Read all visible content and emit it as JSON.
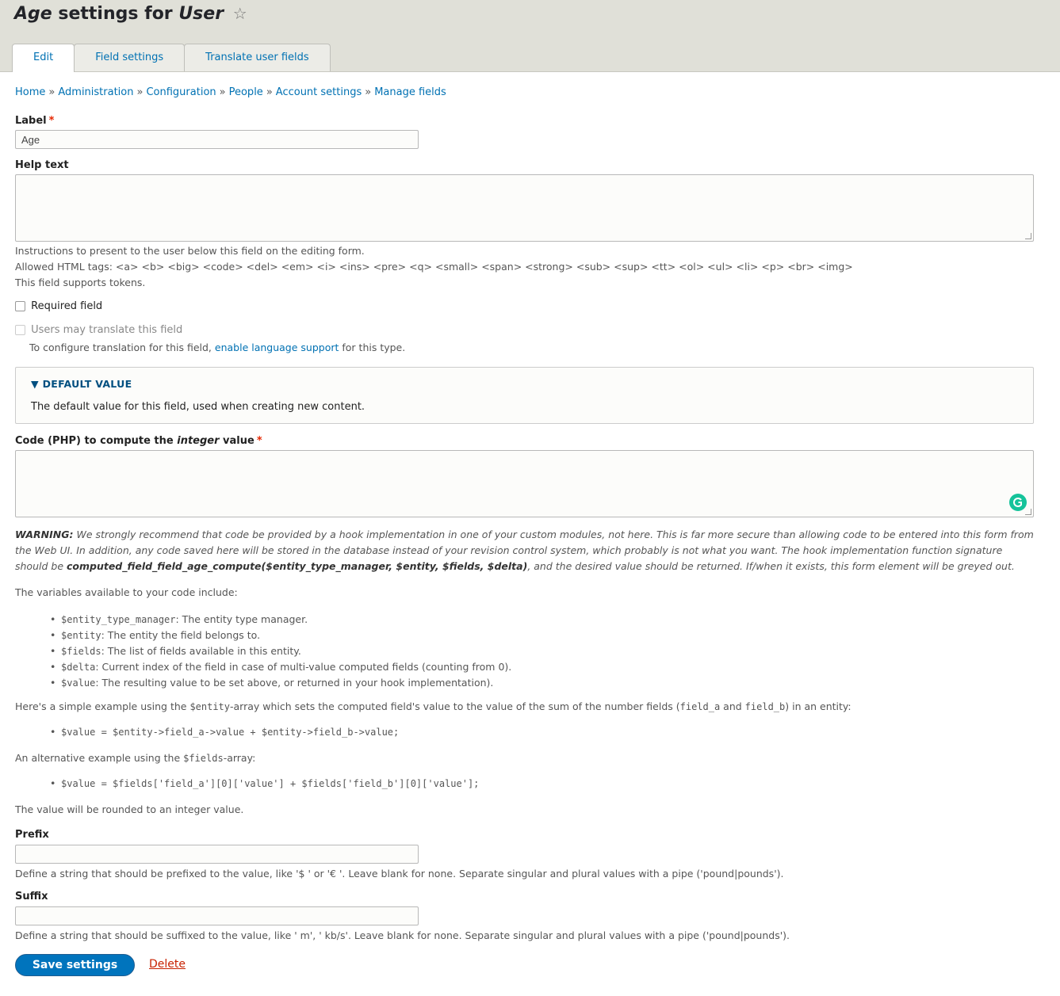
{
  "header": {
    "title_prefix": "Age",
    "title_middle": " settings for ",
    "title_suffix": "User",
    "star": "☆"
  },
  "tabs": [
    {
      "label": "Edit",
      "active": true
    },
    {
      "label": "Field settings",
      "active": false
    },
    {
      "label": "Translate user fields",
      "active": false
    }
  ],
  "breadcrumb": [
    "Home",
    "Administration",
    "Configuration",
    "People",
    "Account settings",
    "Manage fields"
  ],
  "breadcrumb_sep": "»",
  "form": {
    "label": {
      "title": "Label",
      "required_mark": "*",
      "value": "Age"
    },
    "help_text": {
      "title": "Help text",
      "value": "",
      "desc_1": "Instructions to present to the user below this field on the editing form.",
      "desc_2": "Allowed HTML tags: <a> <b> <big> <code> <del> <em> <i> <ins> <pre> <q> <small> <span> <strong> <sub> <sup> <tt> <ol> <ul> <li> <p> <br> <img>",
      "desc_3": "This field supports tokens."
    },
    "required_field": {
      "label": "Required field",
      "checked": false
    },
    "translate": {
      "label": "Users may translate this field",
      "desc_before": "To configure translation for this field, ",
      "link": "enable language support",
      "desc_after": " for this type."
    },
    "default_value": {
      "legend": "▼ DEFAULT VALUE",
      "desc": "The default value for this field, used when creating new content."
    },
    "code": {
      "title_before": "Code (PHP) to compute the ",
      "title_em": "integer",
      "title_after": " value",
      "required_mark": "*",
      "value": ""
    },
    "warning": {
      "strong": "WARNING:",
      "text_1": " We strongly recommend that code be provided by a hook implementation in one of your custom modules, not here. This is far more secure than allowing code to be entered into this form from the Web UI. In addition, any code saved here will be stored in the database instead of your revision control system, which probably is not what you want. The hook implementation function signature should be ",
      "signature": "computed_field_field_age_compute($entity_type_manager, $entity, $fields, $delta)",
      "text_2": ", and the desired value should be returned. If/when it exists, this form element will be greyed out."
    },
    "variables_intro": "The variables available to your code include:",
    "variables": [
      {
        "code": "$entity_type_manager",
        "text": ": The entity type manager."
      },
      {
        "code": "$entity",
        "text": ": The entity the field belongs to."
      },
      {
        "code": "$fields",
        "text": ": The list of fields available in this entity."
      },
      {
        "code": "$delta",
        "text": ": Current index of the field in case of multi-value computed fields (counting from 0)."
      },
      {
        "code": "$value",
        "text": ": The resulting value to be set above, or returned in your hook implementation)."
      }
    ],
    "example_1": {
      "p1": "Here's a simple example using the ",
      "c1": "$entity",
      "p2": "-array which sets the computed field's value to the value of the sum of the number fields (",
      "c2": "field_a",
      "p3": " and ",
      "c3": "field_b",
      "p4": ") in an entity:",
      "code": "$value = $entity->field_a->value + $entity->field_b->value;"
    },
    "example_2": {
      "p1": "An alternative example using the ",
      "c1": "$fields",
      "p2": "-array:",
      "code": "$value = $fields['field_a'][0]['value'] + $fields['field_b'][0]['value'];"
    },
    "rounding_note": "The value will be rounded to an integer value.",
    "prefix": {
      "title": "Prefix",
      "value": "",
      "desc": "Define a string that should be prefixed to the value, like '$ ' or '€ '. Leave blank for none. Separate singular and plural values with a pipe ('pound|pounds')."
    },
    "suffix": {
      "title": "Suffix",
      "value": "",
      "desc": "Define a string that should be suffixed to the value, like ' m', ' kb/s'. Leave blank for none. Separate singular and plural values with a pipe ('pound|pounds')."
    }
  },
  "actions": {
    "save": "Save settings",
    "delete": "Delete"
  },
  "colors": {
    "link": "#0071b3",
    "primary_button": "#0074bd",
    "required": "#e62600",
    "delete": "#c72100",
    "grammarly": "#15c39a"
  },
  "icons": {
    "favorite": "star-icon",
    "grammarly": "grammarly-icon",
    "collapse": "triangle-down-icon"
  }
}
